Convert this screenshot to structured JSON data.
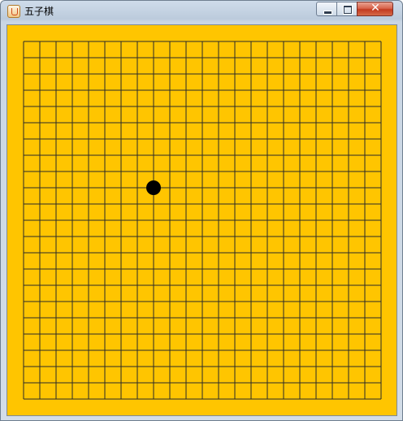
{
  "window": {
    "title": "五子棋",
    "icon": "java-cup-icon",
    "buttons": {
      "minimize": "minimize-icon",
      "maximize": "maximize-icon",
      "close": "close-icon",
      "close_glyph": "✕"
    }
  },
  "board": {
    "background_color": "#ffc500",
    "line_color": "#2a2a2a",
    "grid_lines": 23,
    "stones": [
      {
        "color": "black",
        "col": 8,
        "row": 9
      }
    ]
  }
}
